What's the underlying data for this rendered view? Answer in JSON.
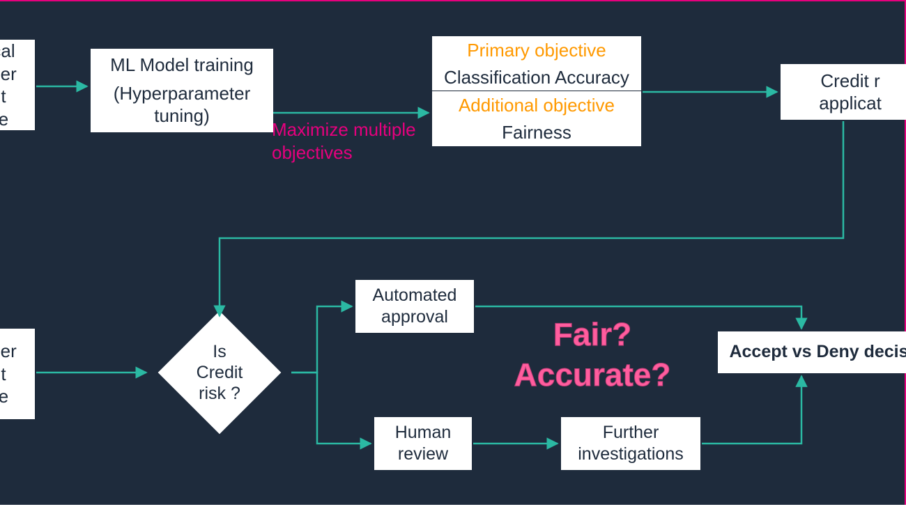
{
  "nodes": {
    "historical": {
      "line1": "cal",
      "line2": "ner",
      "line3": "t",
      "line4": "e"
    },
    "training": {
      "line1": "ML Model training",
      "line2": "(Hyperparameter",
      "line3": "tuning)"
    },
    "objectives": {
      "primary_label": "Primary objective",
      "primary_value": "Classification Accuracy",
      "additional_label": "Additional objective",
      "additional_value": "Fairness"
    },
    "credit_app": {
      "line1": "Credit r",
      "line2": "applicat"
    },
    "customer2": {
      "line1": "ner",
      "line2": "t",
      "line3": "e"
    },
    "decision_diamond": "Is\nCredit\nrisk ?",
    "auto_approval": {
      "line1": "Automated",
      "line2": "approval"
    },
    "human_review": {
      "line1": "Human",
      "line2": "review"
    },
    "further": {
      "line1": "Further",
      "line2": "investigations"
    },
    "final": "Accept vs Deny decis"
  },
  "annotations": {
    "maximize": "Maximize multiple\nobjectives",
    "fair_accurate": "Fair?\nAccurate?"
  },
  "colors": {
    "bg": "#1e2b3c",
    "arrow": "#2bb9a3",
    "pink": "#e6007e",
    "pink_light": "#ff5d9e",
    "orange": "#ff9900"
  }
}
